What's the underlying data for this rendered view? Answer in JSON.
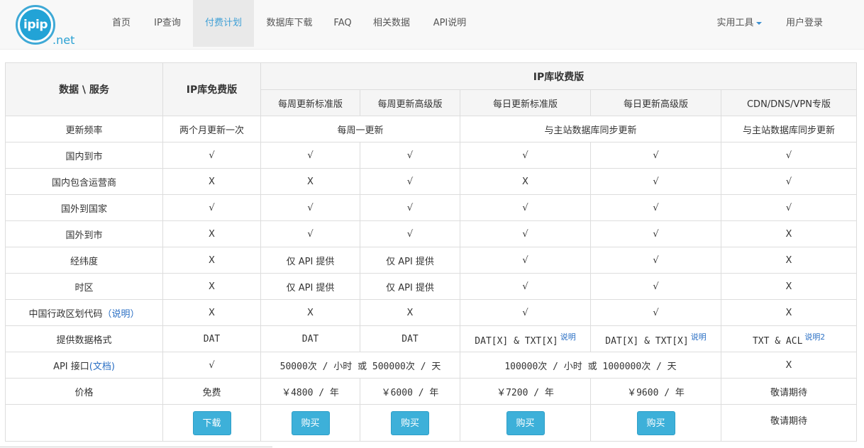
{
  "nav": {
    "logo_text": "ipip",
    "logo_suffix": ".net",
    "items": [
      "首页",
      "IP查询",
      "付费计划",
      "数据库下载",
      "FAQ",
      "相关数据",
      "API说明"
    ],
    "active": "付费计划",
    "tools": "实用工具",
    "login": "用户登录"
  },
  "table": {
    "corner": "数据 \\ 服务",
    "free_title": "IP库免费版",
    "paid_title": "IP库收费版",
    "plans": [
      "每周更新标准版",
      "每周更新高级版",
      "每日更新标准版",
      "每日更新高级版",
      "CDN/DNS/VPN专版"
    ],
    "update": {
      "label": "更新频率",
      "free": "两个月更新一次",
      "weekly": "每周一更新",
      "daily": "与主站数据库同步更新",
      "cdn": "与主站数据库同步更新"
    },
    "rows": [
      {
        "label": "国内到市",
        "cells": [
          "√",
          "√",
          "√",
          "√",
          "√",
          "√"
        ]
      },
      {
        "label": "国内包含运营商",
        "cells": [
          "X",
          "X",
          "√",
          "X",
          "√",
          "√"
        ]
      },
      {
        "label": "国外到国家",
        "cells": [
          "√",
          "√",
          "√",
          "√",
          "√",
          "√"
        ]
      },
      {
        "label": "国外到市",
        "cells": [
          "X",
          "√",
          "√",
          "√",
          "√",
          "X"
        ]
      },
      {
        "label": "经纬度",
        "cells": [
          "X",
          "仅 API 提供",
          "仅 API 提供",
          "√",
          "√",
          "X"
        ]
      },
      {
        "label": "时区",
        "cells": [
          "X",
          "仅 API 提供",
          "仅 API 提供",
          "√",
          "√",
          "X"
        ]
      }
    ],
    "region": {
      "label": "中国行政区划代码",
      "link": "（说明）",
      "cells": [
        "X",
        "X",
        "X",
        "√",
        "√",
        "X"
      ]
    },
    "format": {
      "label": "提供数据格式",
      "cells": [
        "DAT",
        "DAT",
        "DAT",
        "DAT[X] & TXT[X]",
        "DAT[X] & TXT[X]",
        "TXT & ACL"
      ],
      "notes": [
        "说明",
        "说明",
        "说明2"
      ]
    },
    "api": {
      "label_prefix": "API 接口",
      "label_link": "(文档)",
      "free": "√",
      "weekly": "50000次 / 小时 或 500000次 / 天",
      "daily": "100000次 / 小时 或 1000000次 / 天",
      "cdn": "X"
    },
    "price": {
      "label": "价格",
      "cells": [
        "免费",
        "￥4800 / 年",
        "￥6000 / 年",
        "￥7200 / 年",
        "￥9600 / 年",
        "敬请期待"
      ]
    },
    "buttons": {
      "download": "下载",
      "buy": "购买",
      "cdn": "敬请期待"
    }
  },
  "colors": {
    "accent": "#3db0d9",
    "link": "#2a6fc4",
    "header_bg": "#f5f5f5",
    "border": "#dddddd"
  }
}
